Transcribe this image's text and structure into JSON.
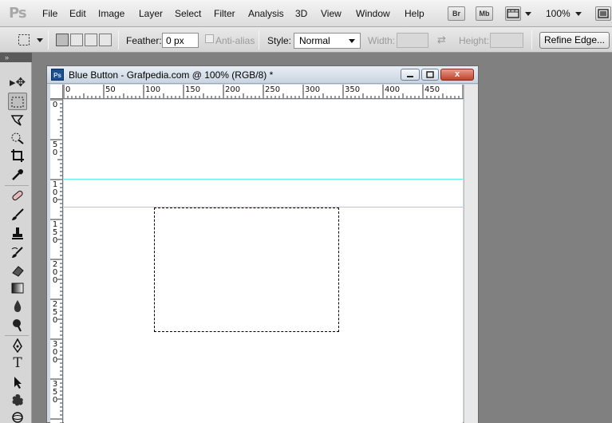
{
  "app": {
    "logo": "Ps",
    "menu": [
      "File",
      "Edit",
      "Image",
      "Layer",
      "Select",
      "Filter",
      "Analysis",
      "3D",
      "View",
      "Window",
      "Help"
    ],
    "bridge_label": "Br",
    "minibridge_label": "Mb",
    "zoom": "100%"
  },
  "options": {
    "feather_label": "Feather:",
    "feather_value": "0 px",
    "antialias_label": "Anti-alias",
    "style_label": "Style:",
    "style_value": "Normal",
    "width_label": "Width:",
    "height_label": "Height:",
    "refine_edge_label": "Refine Edge..."
  },
  "document": {
    "title": "Blue Button - Grafpedia.com @ 100% (RGB/8) *",
    "close_label": "x",
    "ruler_h_labels": [
      "0",
      "50",
      "100",
      "150",
      "200",
      "250",
      "300",
      "350",
      "400",
      "450"
    ],
    "ruler_v_labels": [
      "0",
      "5 0",
      "1 0 0",
      "1 5 0",
      "2 0 0",
      "2 5 0",
      "3 0 0",
      "3 5 0"
    ]
  },
  "colors": {
    "guide": "#5ff0ea",
    "canvas": "#ffffff",
    "workspace": "#808080"
  },
  "icons": {
    "tools": [
      "move-icon",
      "marquee-icon",
      "lasso-icon",
      "quick-select-icon",
      "crop-icon",
      "eyedropper-icon",
      "healing-icon",
      "brush-icon",
      "stamp-icon",
      "history-brush-icon",
      "eraser-icon",
      "gradient-icon",
      "blur-icon",
      "dodge-icon",
      "pen-icon",
      "type-icon",
      "path-select-icon",
      "shape-icon",
      "3d-icon"
    ]
  }
}
